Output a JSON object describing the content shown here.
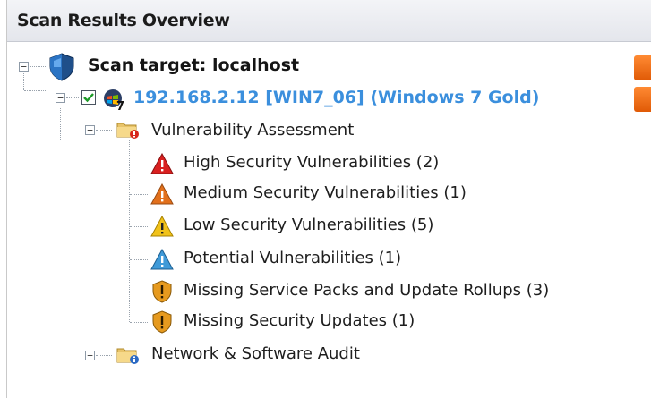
{
  "panel": {
    "title": "Scan Results Overview"
  },
  "tree": {
    "root": {
      "label": "Scan target: localhost",
      "expanded": true,
      "icon": "shield-icon"
    },
    "host": {
      "label": "192.168.2.12 [WIN7_06] (Windows 7 Gold)",
      "checked": true,
      "expanded": true,
      "icon": "windows-computer-icon"
    },
    "vulnerability_assessment": {
      "label": "Vulnerability Assessment",
      "expanded": true,
      "icon": "folder-alert-icon",
      "items": [
        {
          "label": "High Security Vulnerabilities (2)",
          "icon": "warning-red-icon",
          "color": "#d92020"
        },
        {
          "label": "Medium Security Vulnerabilities (1)",
          "icon": "warning-orange-icon",
          "color": "#e2701c"
        },
        {
          "label": "Low Security Vulnerabilities (5)",
          "icon": "warning-yellow-icon",
          "color": "#f1c21a"
        },
        {
          "label": "Potential Vulnerabilities (1)",
          "icon": "warning-blue-icon",
          "color": "#3f9ad8"
        },
        {
          "label": "Missing Service Packs and Update Rollups (3)",
          "icon": "shield-exclamation-icon",
          "color": "#e69a1f"
        },
        {
          "label": "Missing Security Updates (1)",
          "icon": "shield-exclamation-icon",
          "color": "#e69a1f"
        }
      ]
    },
    "network_audit": {
      "label": "Network & Software Audit",
      "expanded": false,
      "icon": "folder-info-icon"
    }
  },
  "colors": {
    "host_link": "#3b8fdd",
    "side_button": "#f06a0d"
  }
}
